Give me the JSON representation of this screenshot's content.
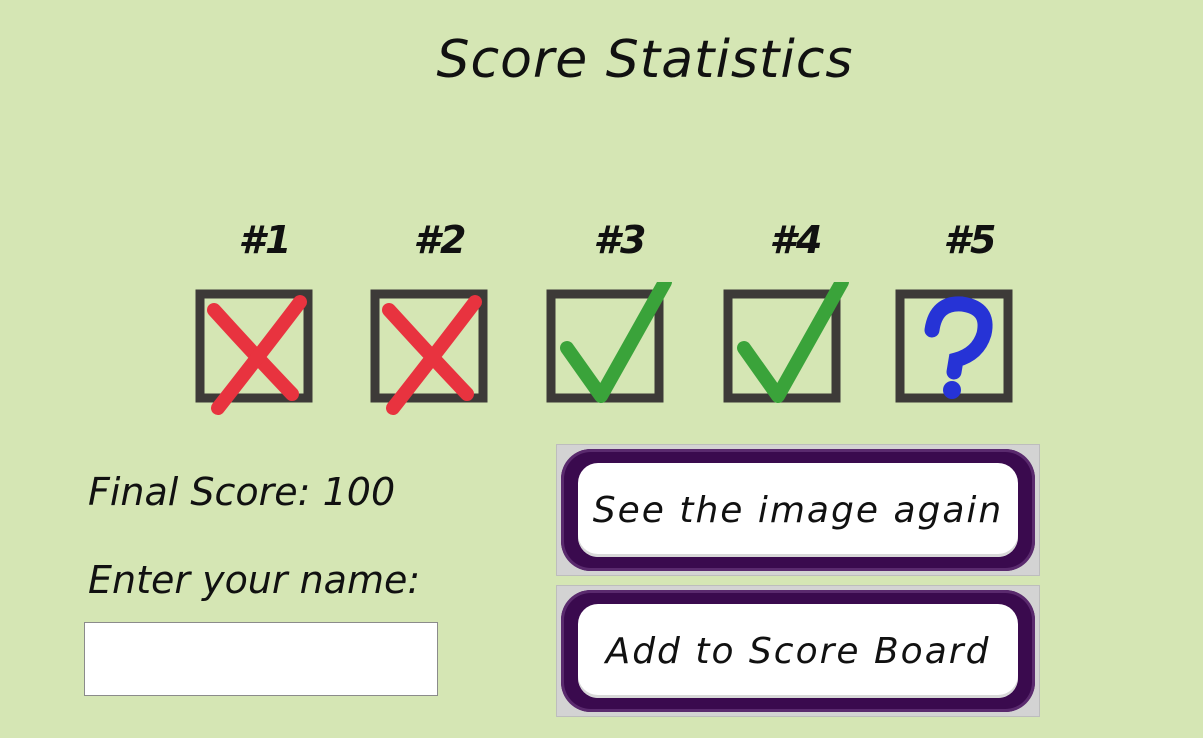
{
  "title": "Score Statistics",
  "questions": [
    {
      "label": "#1",
      "result": "wrong",
      "icon": "red-x-icon"
    },
    {
      "label": "#2",
      "result": "wrong",
      "icon": "red-x-icon"
    },
    {
      "label": "#3",
      "result": "correct",
      "icon": "green-check-icon"
    },
    {
      "label": "#4",
      "result": "correct",
      "icon": "green-check-icon"
    },
    {
      "label": "#5",
      "result": "unknown",
      "icon": "blue-question-icon"
    }
  ],
  "final_score": {
    "label": "Final Score:",
    "value": "100"
  },
  "name_prompt": "Enter your name:",
  "name_input": {
    "value": "",
    "placeholder": ""
  },
  "buttons": {
    "see_image_again": "See the image again",
    "add_to_score_board": "Add to Score Board"
  },
  "colors": {
    "background": "#d5e6b4",
    "wrong": "#e8333f",
    "correct": "#3aa33a",
    "unknown": "#2633d6",
    "button_border": "#3a0a4e"
  }
}
